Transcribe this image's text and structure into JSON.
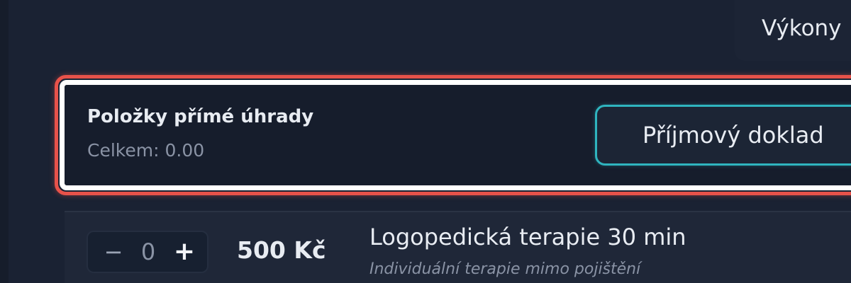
{
  "header": {
    "tab_label": "Výkony"
  },
  "payment_panel": {
    "title": "Položky přímé úhrady",
    "total": "Celkem: 0.00",
    "receipt_button_label": "Příjmový doklad"
  },
  "items": [
    {
      "quantity": "0",
      "minus_symbol": "−",
      "plus_symbol": "+",
      "price": "500 Kč",
      "name": "Logopedická terapie 30 min",
      "description": "Individuální terapie mimo pojištění"
    }
  ],
  "colors": {
    "background": "#1a2233",
    "highlight_outer": "#e8524a",
    "highlight_inner": "#ffffff",
    "button_accent": "#2fb4bf"
  }
}
